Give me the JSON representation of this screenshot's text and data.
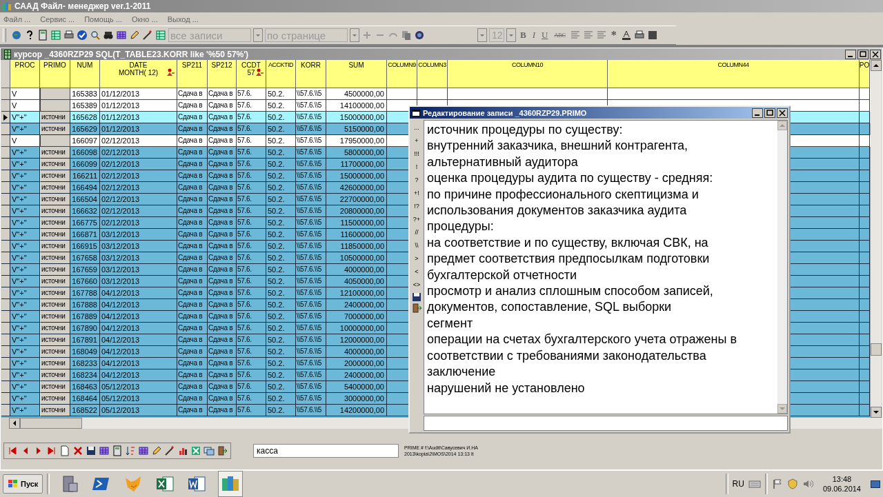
{
  "window": {
    "title": "СААД Файл- менеджер ver.1-2011"
  },
  "menu": [
    "Файл ...",
    "Сервис ...",
    "Помощь ...",
    "Окно ...",
    "Выход ..."
  ],
  "toolbar": {
    "filter": "все записи",
    "paging": "по странице",
    "font_size": "12",
    "format_buttons": [
      "B",
      "I",
      "U",
      "ABC"
    ],
    "star": "*"
  },
  "cursor_window": {
    "title": "курсор _4360RZP29 SQL(T_TABLE23.KORR like '%50 57%')",
    "columns": [
      {
        "label": "PROC",
        "sorted": false
      },
      {
        "label": "PRIMO",
        "sorted": false
      },
      {
        "label": "NUM",
        "sorted": false
      },
      {
        "label": "DATE",
        "sub": "MONTH( 12)",
        "sorted": true
      },
      {
        "label": "SP211",
        "sorted": false
      },
      {
        "label": "SP212",
        "sorted": false
      },
      {
        "label": "CCDT",
        "sub": "57",
        "sorted": true
      },
      {
        "label": "ACCKTID",
        "sorted": false
      },
      {
        "label": "KORR",
        "sorted": false
      },
      {
        "label": "SUM",
        "sorted": false
      },
      {
        "label": "COLUMN9",
        "sorted": false
      },
      {
        "label": "COLUMN3",
        "sorted": false
      },
      {
        "label": "COLUMN10",
        "sorted": false
      },
      {
        "label": "COLUMN44",
        "sorted": false
      },
      {
        "label": "PO",
        "sorted": false
      }
    ],
    "rows": [
      {
        "proc": "V",
        "num": "165383",
        "date": "01/12/2013",
        "sp211": "Сдача в",
        "sp212": "Сдача в",
        "ccdt": "57.6.",
        "acckttd": "50.2.",
        "korr": "\\\\57.6.\\\\5",
        "sum": "4500000,00",
        "marked": false,
        "selected": false
      },
      {
        "proc": "V",
        "num": "165389",
        "date": "01/12/2013",
        "sp211": "Сдача в",
        "sp212": "Сдача в",
        "ccdt": "57.6.",
        "acckttd": "50.2.",
        "korr": "\\\\57.6.\\\\5",
        "sum": "14100000,00",
        "marked": false,
        "selected": false
      },
      {
        "proc": "V\"+\"",
        "primo": "источни",
        "num": "165628",
        "date": "01/12/2013",
        "sp211": "Сдача в",
        "sp212": "Сдача в",
        "ccdt": "57.6.",
        "acckttd": "50.2.",
        "korr": "\\\\57.6.\\\\5",
        "sum": "15000000,00",
        "marked": true,
        "selected": true
      },
      {
        "proc": "V\"+\"",
        "primo": "источни",
        "num": "165629",
        "date": "01/12/2013",
        "sp211": "Сдача в",
        "sp212": "Сдача в",
        "ccdt": "57.6.",
        "acckttd": "50.2.",
        "korr": "\\\\57.6.\\\\5",
        "sum": "5150000,00",
        "marked": true,
        "selected": false
      },
      {
        "proc": "V",
        "num": "166097",
        "date": "02/12/2013",
        "sp211": "Сдача в",
        "sp212": "Сдача в",
        "ccdt": "57.6.",
        "acckttd": "50.2.",
        "korr": "\\\\57.6.\\\\5",
        "sum": "17950000,00",
        "marked": false,
        "selected": false
      },
      {
        "proc": "V\"+\"",
        "primo": "источни",
        "num": "166098",
        "date": "02/12/2013",
        "sp211": "Сдача в",
        "sp212": "Сдача в",
        "ccdt": "57.6.",
        "acckttd": "50.2.",
        "korr": "\\\\57.6.\\\\5",
        "sum": "5800000,00",
        "marked": true,
        "selected": false
      },
      {
        "proc": "V\"+\"",
        "primo": "источни",
        "num": "166099",
        "date": "02/12/2013",
        "sp211": "Сдача в",
        "sp212": "Сдача в",
        "ccdt": "57.6.",
        "acckttd": "50.2.",
        "korr": "\\\\57.6.\\\\5",
        "sum": "11700000,00",
        "marked": true,
        "selected": false
      },
      {
        "proc": "V\"+\"",
        "primo": "источни",
        "num": "166211",
        "date": "02/12/2013",
        "sp211": "Сдача в",
        "sp212": "Сдача в",
        "ccdt": "57.6.",
        "acckttd": "50.2.",
        "korr": "\\\\57.6.\\\\5",
        "sum": "15000000,00",
        "marked": true,
        "selected": false
      },
      {
        "proc": "V\"+\"",
        "primo": "источни",
        "num": "166494",
        "date": "02/12/2013",
        "sp211": "Сдача в",
        "sp212": "Сдача в",
        "ccdt": "57.6.",
        "acckttd": "50.2.",
        "korr": "\\\\57.6.\\\\5",
        "sum": "42600000,00",
        "marked": true,
        "selected": false
      },
      {
        "proc": "V\"+\"",
        "primo": "источни",
        "num": "166504",
        "date": "02/12/2013",
        "sp211": "Сдача в",
        "sp212": "Сдача в",
        "ccdt": "57.6.",
        "acckttd": "50.2.",
        "korr": "\\\\57.6.\\\\5",
        "sum": "22700000,00",
        "marked": true,
        "selected": false
      },
      {
        "proc": "V\"+\"",
        "primo": "источни",
        "num": "166632",
        "date": "02/12/2013",
        "sp211": "Сдача в",
        "sp212": "Сдача в",
        "ccdt": "57.6.",
        "acckttd": "50.2.",
        "korr": "\\\\57.6.\\\\5",
        "sum": "20800000,00",
        "marked": true,
        "selected": false
      },
      {
        "proc": "V\"+\"",
        "primo": "источни",
        "num": "166775",
        "date": "02/12/2013",
        "sp211": "Сдача в",
        "sp212": "Сдача в",
        "ccdt": "57.6.",
        "acckttd": "50.2.",
        "korr": "\\\\57.6.\\\\5",
        "sum": "11500000,00",
        "marked": true,
        "selected": false
      },
      {
        "proc": "V\"+\"",
        "primo": "источни",
        "num": "166871",
        "date": "03/12/2013",
        "sp211": "Сдача в",
        "sp212": "Сдача в",
        "ccdt": "57.6.",
        "acckttd": "50.2.",
        "korr": "\\\\57.6.\\\\5",
        "sum": "11600000,00",
        "marked": true,
        "selected": false
      },
      {
        "proc": "V\"+\"",
        "primo": "источни",
        "num": "166915",
        "date": "03/12/2013",
        "sp211": "Сдача в",
        "sp212": "Сдача в",
        "ccdt": "57.6.",
        "acckttd": "50.2.",
        "korr": "\\\\57.6.\\\\5",
        "sum": "11850000,00",
        "marked": true,
        "selected": false
      },
      {
        "proc": "V\"+\"",
        "primo": "источни",
        "num": "167658",
        "date": "03/12/2013",
        "sp211": "Сдача в",
        "sp212": "Сдача в",
        "ccdt": "57.6.",
        "acckttd": "50.2.",
        "korr": "\\\\57.6.\\\\5",
        "sum": "10500000,00",
        "marked": true,
        "selected": false
      },
      {
        "proc": "V\"+\"",
        "primo": "источни",
        "num": "167659",
        "date": "03/12/2013",
        "sp211": "Сдача в",
        "sp212": "Сдача в",
        "ccdt": "57.6.",
        "acckttd": "50.2.",
        "korr": "\\\\57.6.\\\\5",
        "sum": "4000000,00",
        "marked": true,
        "selected": false
      },
      {
        "proc": "V\"+\"",
        "primo": "источни",
        "num": "167660",
        "date": "03/12/2013",
        "sp211": "Сдача в",
        "sp212": "Сдача в",
        "ccdt": "57.6.",
        "acckttd": "50.2.",
        "korr": "\\\\57.6.\\\\5",
        "sum": "4050000,00",
        "marked": true,
        "selected": false
      },
      {
        "proc": "V\"+\"",
        "primo": "источни",
        "num": "167788",
        "date": "04/12/2013",
        "sp211": "Сдача в",
        "sp212": "Сдача в",
        "ccdt": "57.6.",
        "acckttd": "50.2.",
        "korr": "\\\\57.6.\\\\5",
        "sum": "12100000,00",
        "marked": true,
        "selected": false
      },
      {
        "proc": "V\"+\"",
        "primo": "источни",
        "num": "167888",
        "date": "04/12/2013",
        "sp211": "Сдача в",
        "sp212": "Сдача в",
        "ccdt": "57.6.",
        "acckttd": "50.2.",
        "korr": "\\\\57.6.\\\\5",
        "sum": "2400000,00",
        "marked": true,
        "selected": false
      },
      {
        "proc": "V\"+\"",
        "primo": "источни",
        "num": "167889",
        "date": "04/12/2013",
        "sp211": "Сдача в",
        "sp212": "Сдача в",
        "ccdt": "57.6.",
        "acckttd": "50.2.",
        "korr": "\\\\57.6.\\\\5",
        "sum": "7000000,00",
        "marked": true,
        "selected": false
      },
      {
        "proc": "V\"+\"",
        "primo": "источни",
        "num": "167890",
        "date": "04/12/2013",
        "sp211": "Сдача в",
        "sp212": "Сдача в",
        "ccdt": "57.6.",
        "acckttd": "50.2.",
        "korr": "\\\\57.6.\\\\5",
        "sum": "10000000,00",
        "marked": true,
        "selected": false
      },
      {
        "proc": "V\"+\"",
        "primo": "источни",
        "num": "167891",
        "date": "04/12/2013",
        "sp211": "Сдача в",
        "sp212": "Сдача в",
        "ccdt": "57.6.",
        "acckttd": "50.2.",
        "korr": "\\\\57.6.\\\\5",
        "sum": "12000000,00",
        "marked": true,
        "selected": false
      },
      {
        "proc": "V\"+\"",
        "primo": "источни",
        "num": "168049",
        "date": "04/12/2013",
        "sp211": "Сдача в",
        "sp212": "Сдача в",
        "ccdt": "57.6.",
        "acckttd": "50.2.",
        "korr": "\\\\57.6.\\\\5",
        "sum": "4000000,00",
        "marked": true,
        "selected": false
      },
      {
        "proc": "V\"+\"",
        "primo": "источни",
        "num": "168233",
        "date": "04/12/2013",
        "sp211": "Сдача в",
        "sp212": "Сдача в",
        "ccdt": "57.6.",
        "acckttd": "50.2.",
        "korr": "\\\\57.6.\\\\5",
        "sum": "2000000,00",
        "marked": true,
        "selected": false
      },
      {
        "proc": "V\"+\"",
        "primo": "источни",
        "num": "168234",
        "date": "04/12/2013",
        "sp211": "Сдача в",
        "sp212": "Сдача в",
        "ccdt": "57.6.",
        "acckttd": "50.2.",
        "korr": "\\\\57.6.\\\\5",
        "sum": "2400000,00",
        "marked": true,
        "selected": false
      },
      {
        "proc": "V\"+\"",
        "primo": "источни",
        "num": "168463",
        "date": "05/12/2013",
        "sp211": "Сдача в",
        "sp212": "Сдача в",
        "ccdt": "57.6.",
        "acckttd": "50.2.",
        "korr": "\\\\57.6.\\\\5",
        "sum": "5400000,00",
        "marked": true,
        "selected": false
      },
      {
        "proc": "V\"+\"",
        "primo": "источни",
        "num": "168464",
        "date": "05/12/2013",
        "sp211": "Сдача в",
        "sp212": "Сдача в",
        "ccdt": "57.6.",
        "acckttd": "50.2.",
        "korr": "\\\\57.6.\\\\5",
        "sum": "3000000,00",
        "marked": true,
        "selected": false
      },
      {
        "proc": "V\"+\"",
        "primo": "источни",
        "num": "168522",
        "date": "05/12/2013",
        "sp211": "Сдача в",
        "sp212": "Сдача в",
        "ccdt": "57.6.",
        "acckttd": "50.2.",
        "korr": "\\\\57.6.\\\\5",
        "sum": "14200000,00",
        "marked": true,
        "selected": false
      }
    ]
  },
  "editor": {
    "title": "Редактирование записи _4360RZP29.PRIMO",
    "tools": [
      "...",
      "+",
      "!!!",
      "!",
      "?",
      "+!",
      "!?",
      "?+",
      "//",
      "\\\\",
      ">",
      "<",
      "<>"
    ],
    "lines": [
      "источник процедуры по существу:",
      "внутренний заказчика, внешний контрагента,",
      "альтернативный аудитора",
      "оценка процедуры аудита по существу - средняя:",
      "по причине профессионального скептицизма и",
      "использования документов заказчика аудита",
      "процедуры:",
      "на соответствие и по существу, включая СВК, на",
      "предмет соответствия предпосылкам подготовки",
      "бухгалтерской отчетности",
      "просмотр и анализ сплошным способом записей,",
      "документов, сопоставление, SQL выборки",
      "сегмент",
      "операции на счетах бухгалтерского учета отражены в",
      "соответствии с требованиями законодательства",
      "заключение",
      "нарушений не установлено"
    ]
  },
  "navigator": {
    "search": "касса",
    "path_lines": [
      "PRIME # f:\\Audit\\Савусевич И.НА",
      "2013\\kopia\\2\\MOS\\2014 13:13 lt"
    ]
  },
  "taskbar": {
    "start": "Пуск",
    "language": "RU",
    "time": "13:48",
    "date": "09.06.2014"
  }
}
